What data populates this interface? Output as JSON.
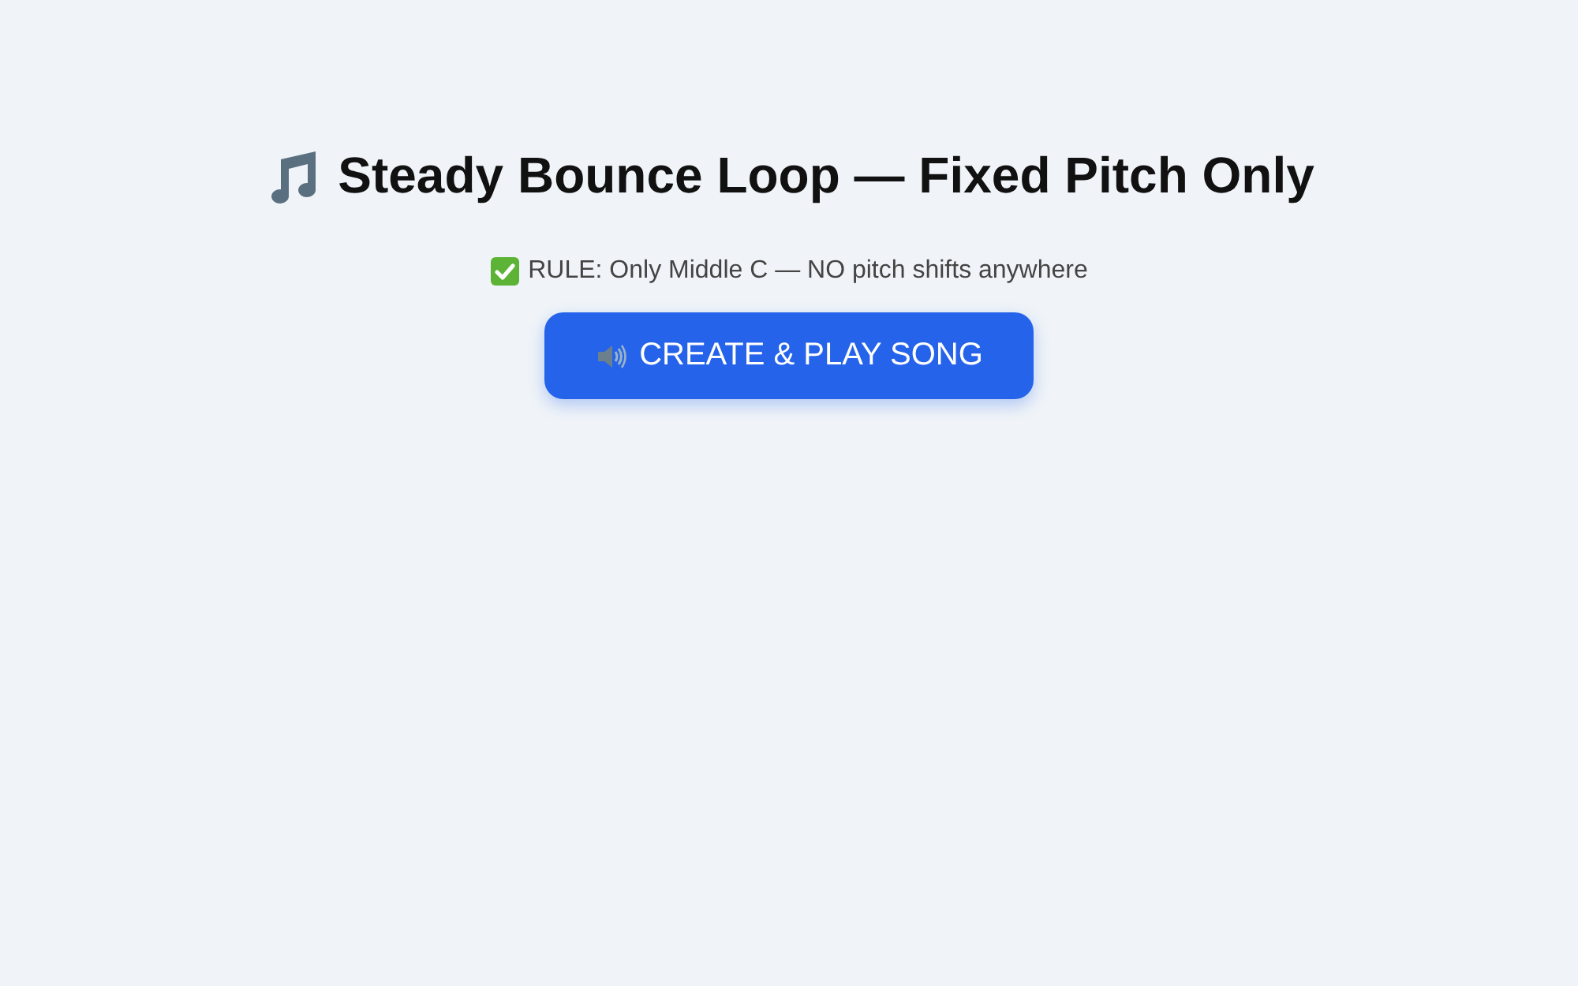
{
  "title": "Steady Bounce Loop — Fixed Pitch Only",
  "rule": "RULE: Only Middle C — NO pitch shifts anywhere",
  "play_button": {
    "label": "CREATE & PLAY SONG"
  }
}
